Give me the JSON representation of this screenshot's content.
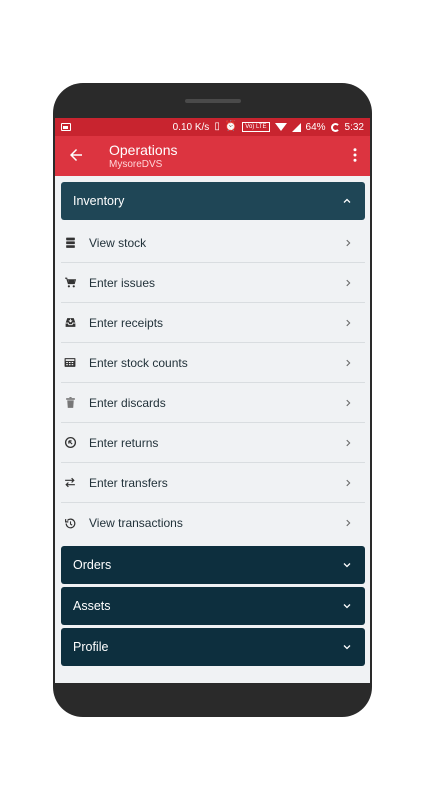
{
  "status_bar": {
    "speed": "0.10 K/s",
    "volte": "Vo) LTE",
    "battery": "64%",
    "time": "5:32"
  },
  "app_bar": {
    "title": "Operations",
    "subtitle": "MysoreDVS"
  },
  "sections": {
    "inventory": {
      "label": "Inventory",
      "expanded": true,
      "items": [
        {
          "label": "View stock",
          "icon": "stack-icon"
        },
        {
          "label": "Enter issues",
          "icon": "cart-icon"
        },
        {
          "label": "Enter receipts",
          "icon": "inbox-icon"
        },
        {
          "label": "Enter stock counts",
          "icon": "calculator-icon"
        },
        {
          "label": "Enter discards",
          "icon": "trash-icon"
        },
        {
          "label": "Enter returns",
          "icon": "return-icon"
        },
        {
          "label": "Enter transfers",
          "icon": "transfer-icon"
        },
        {
          "label": "View transactions",
          "icon": "history-icon"
        }
      ]
    },
    "orders": {
      "label": "Orders",
      "expanded": false
    },
    "assets": {
      "label": "Assets",
      "expanded": false
    },
    "profile": {
      "label": "Profile",
      "expanded": false
    }
  },
  "colors": {
    "status_bar": "#c8242f",
    "app_bar": "#dc3440",
    "inventory_header": "#1f4656",
    "section_header": "#0d2f3e"
  }
}
